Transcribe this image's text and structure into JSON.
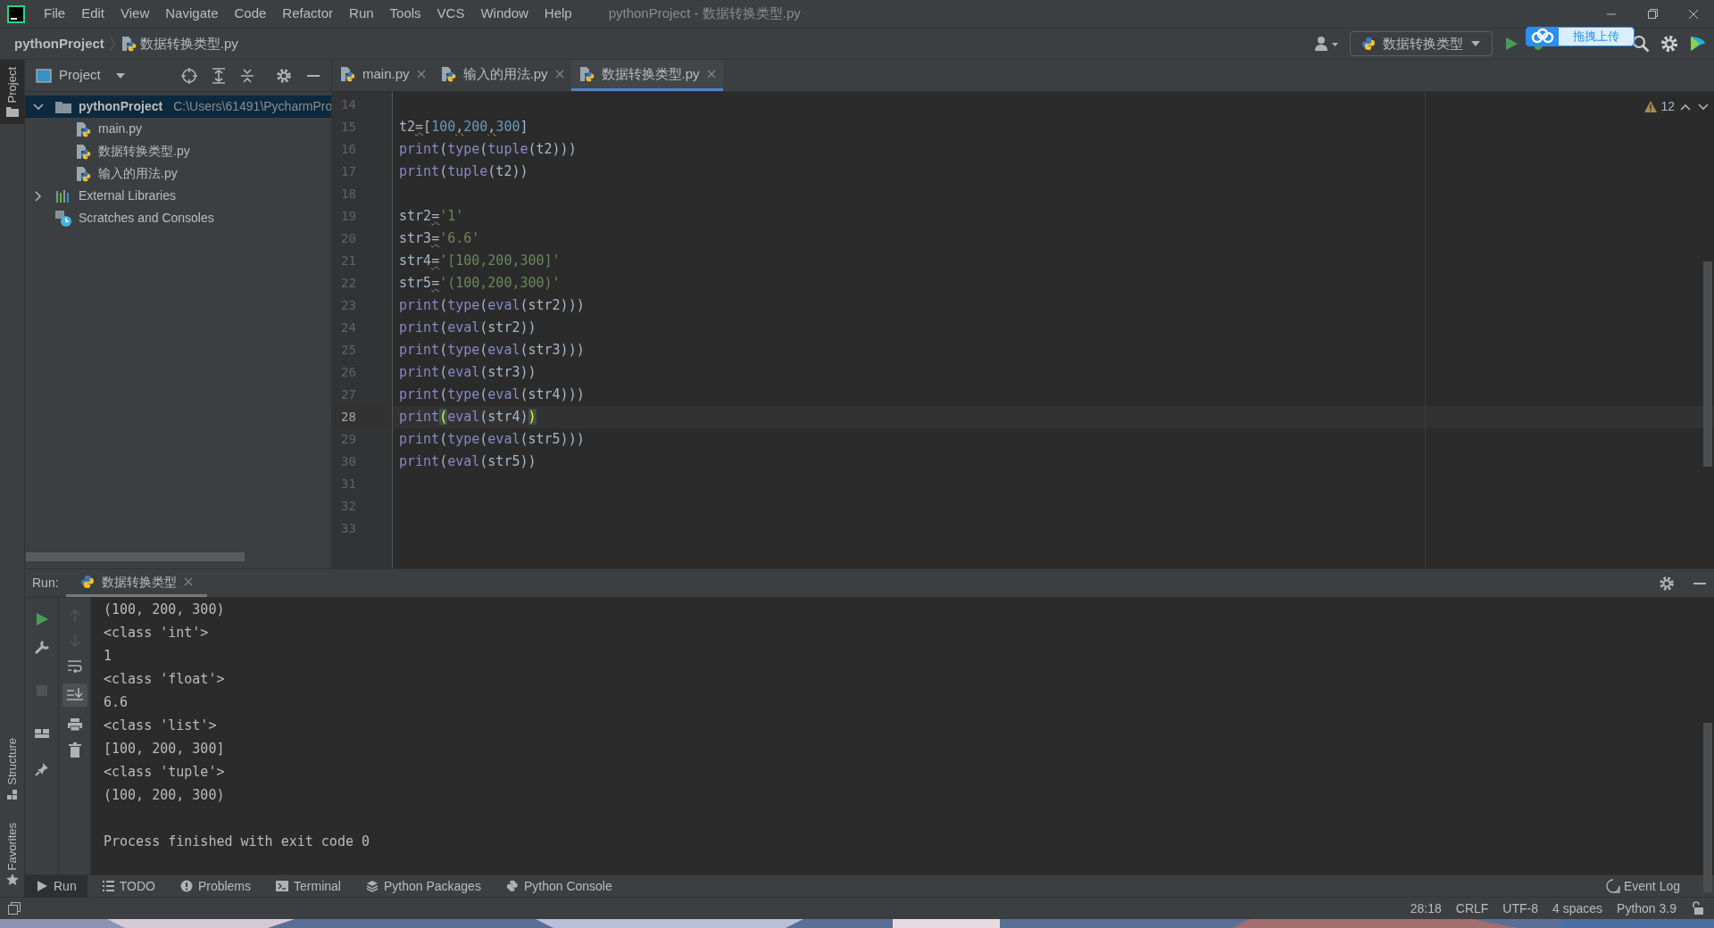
{
  "window": {
    "title": "pythonProject - 数据转换类型.py"
  },
  "menu": [
    "File",
    "Edit",
    "View",
    "Navigate",
    "Code",
    "Refactor",
    "Run",
    "Tools",
    "VCS",
    "Window",
    "Help"
  ],
  "breadcrumb": [
    "pythonProject",
    "数据转换类型.py"
  ],
  "toolbar": {
    "run_configuration": "数据转换类型"
  },
  "upload_popup": {
    "label": "拖拽上传"
  },
  "side_stripe": {
    "top": [
      {
        "label": "Project",
        "selected": true
      }
    ],
    "bottom": [
      {
        "label": "Structure",
        "selected": false
      },
      {
        "label": "Favorites",
        "selected": false
      }
    ]
  },
  "project_panel": {
    "title": "Project",
    "tree": [
      {
        "label": "pythonProject",
        "path": "C:\\Users\\61491\\PycharmPro",
        "kind": "folder",
        "expanded": true,
        "selected": true,
        "children": [
          {
            "label": "main.py",
            "kind": "python_file",
            "selected": false
          },
          {
            "label": "数据转换类型.py",
            "kind": "python_file",
            "selected": false
          },
          {
            "label": "输入的用法.py",
            "kind": "python_file",
            "selected": false
          }
        ]
      },
      {
        "label": "External Libraries",
        "kind": "libraries",
        "expanded": false,
        "selected": false
      },
      {
        "label": "Scratches and Consoles",
        "kind": "scratches",
        "selected": false
      }
    ]
  },
  "tabs": [
    {
      "label": "main.py",
      "selected": false
    },
    {
      "label": "输入的用法.py",
      "selected": false
    },
    {
      "label": "数据转换类型.py",
      "selected": true
    }
  ],
  "editor": {
    "warning_count": "12",
    "lines": [
      {
        "number": "14",
        "current": false
      },
      {
        "number": "15",
        "current": false,
        "tokens": [
          {
            "text": "t2",
            "kind": "plain"
          },
          {
            "text": "=",
            "kind": "weak_warning"
          },
          {
            "text": "[",
            "kind": "plain"
          },
          {
            "text": "100",
            "kind": "number"
          },
          {
            "text": ",",
            "kind": "warning"
          },
          {
            "text": "200",
            "kind": "number"
          },
          {
            "text": ",",
            "kind": "warning"
          },
          {
            "text": "300",
            "kind": "number"
          },
          {
            "text": "]",
            "kind": "plain"
          }
        ]
      },
      {
        "number": "16",
        "current": false,
        "tokens": [
          {
            "text": "print",
            "kind": "builtin"
          },
          {
            "text": "(",
            "kind": "plain"
          },
          {
            "text": "type",
            "kind": "builtin"
          },
          {
            "text": "(",
            "kind": "plain"
          },
          {
            "text": "tuple",
            "kind": "builtin"
          },
          {
            "text": "(t2)))",
            "kind": "plain"
          }
        ]
      },
      {
        "number": "17",
        "current": false,
        "tokens": [
          {
            "text": "print",
            "kind": "builtin"
          },
          {
            "text": "(",
            "kind": "plain"
          },
          {
            "text": "tuple",
            "kind": "builtin"
          },
          {
            "text": "(t2))",
            "kind": "plain"
          }
        ]
      },
      {
        "number": "18",
        "current": false
      },
      {
        "number": "19",
        "current": false,
        "tokens": [
          {
            "text": "str2",
            "kind": "plain"
          },
          {
            "text": "=",
            "kind": "weak_warning"
          },
          {
            "text": "'1'",
            "kind": "string"
          }
        ]
      },
      {
        "number": "20",
        "current": false,
        "tokens": [
          {
            "text": "str3",
            "kind": "plain"
          },
          {
            "text": "=",
            "kind": "weak_warning"
          },
          {
            "text": "'6.6'",
            "kind": "string"
          }
        ]
      },
      {
        "number": "21",
        "current": false,
        "tokens": [
          {
            "text": "str4",
            "kind": "plain"
          },
          {
            "text": "=",
            "kind": "weak_warning"
          },
          {
            "text": "'[100,200,300]'",
            "kind": "string"
          }
        ]
      },
      {
        "number": "22",
        "current": false,
        "tokens": [
          {
            "text": "str5",
            "kind": "plain"
          },
          {
            "text": "=",
            "kind": "weak_warning"
          },
          {
            "text": "'(100,200,300)'",
            "kind": "string"
          }
        ]
      },
      {
        "number": "23",
        "current": false,
        "tokens": [
          {
            "text": "print",
            "kind": "builtin"
          },
          {
            "text": "(",
            "kind": "plain"
          },
          {
            "text": "type",
            "kind": "builtin"
          },
          {
            "text": "(",
            "kind": "plain"
          },
          {
            "text": "eval",
            "kind": "builtin"
          },
          {
            "text": "(str2)))",
            "kind": "plain"
          }
        ]
      },
      {
        "number": "24",
        "current": false,
        "tokens": [
          {
            "text": "print",
            "kind": "builtin"
          },
          {
            "text": "(",
            "kind": "plain"
          },
          {
            "text": "eval",
            "kind": "builtin"
          },
          {
            "text": "(str2))",
            "kind": "plain"
          }
        ]
      },
      {
        "number": "25",
        "current": false,
        "tokens": [
          {
            "text": "print",
            "kind": "builtin"
          },
          {
            "text": "(",
            "kind": "plain"
          },
          {
            "text": "type",
            "kind": "builtin"
          },
          {
            "text": "(",
            "kind": "plain"
          },
          {
            "text": "eval",
            "kind": "builtin"
          },
          {
            "text": "(str3)))",
            "kind": "plain"
          }
        ]
      },
      {
        "number": "26",
        "current": false,
        "tokens": [
          {
            "text": "print",
            "kind": "builtin"
          },
          {
            "text": "(",
            "kind": "plain"
          },
          {
            "text": "eval",
            "kind": "builtin"
          },
          {
            "text": "(str3))",
            "kind": "plain"
          }
        ]
      },
      {
        "number": "27",
        "current": false,
        "tokens": [
          {
            "text": "print",
            "kind": "builtin"
          },
          {
            "text": "(",
            "kind": "plain"
          },
          {
            "text": "type",
            "kind": "builtin"
          },
          {
            "text": "(",
            "kind": "plain"
          },
          {
            "text": "eval",
            "kind": "builtin"
          },
          {
            "text": "(str4)))",
            "kind": "plain"
          }
        ]
      },
      {
        "number": "28",
        "current": true,
        "tokens": [
          {
            "text": "print",
            "kind": "builtin"
          },
          {
            "text": "(",
            "kind": "brace_match"
          },
          {
            "text": "eval",
            "kind": "builtin"
          },
          {
            "text": "(str4)",
            "kind": "plain"
          },
          {
            "text": ")",
            "kind": "brace_match"
          }
        ]
      },
      {
        "number": "29",
        "current": false,
        "tokens": [
          {
            "text": "print",
            "kind": "builtin"
          },
          {
            "text": "(",
            "kind": "plain"
          },
          {
            "text": "type",
            "kind": "builtin"
          },
          {
            "text": "(",
            "kind": "plain"
          },
          {
            "text": "eval",
            "kind": "builtin"
          },
          {
            "text": "(str5)))",
            "kind": "plain"
          }
        ]
      },
      {
        "number": "30",
        "current": false,
        "tokens": [
          {
            "text": "print",
            "kind": "builtin"
          },
          {
            "text": "(",
            "kind": "plain"
          },
          {
            "text": "eval",
            "kind": "builtin"
          },
          {
            "text": "(str5))",
            "kind": "plain"
          }
        ]
      },
      {
        "number": "31",
        "current": false
      },
      {
        "number": "32",
        "current": false
      },
      {
        "number": "33",
        "current": false
      }
    ]
  },
  "run_panel": {
    "label": "Run:",
    "tab": "数据转换类型",
    "output": [
      "(100, 200, 300)",
      "<class 'int'>",
      "1",
      "<class 'float'>",
      "6.6",
      "<class 'list'>",
      "[100, 200, 300]",
      "<class 'tuple'>",
      "(100, 200, 300)"
    ],
    "exit_message": "Process finished with exit code 0"
  },
  "tool_tabs": [
    {
      "label": "Run",
      "kind": "run",
      "selected": true
    },
    {
      "label": "TODO",
      "kind": "todo",
      "selected": false
    },
    {
      "label": "Problems",
      "kind": "problems",
      "selected": false
    },
    {
      "label": "Terminal",
      "kind": "terminal",
      "selected": false
    },
    {
      "label": "Python Packages",
      "kind": "packages",
      "selected": false
    },
    {
      "label": "Python Console",
      "kind": "console",
      "selected": false
    }
  ],
  "event_log": "Event Log",
  "status_bar": [
    "28:18",
    "CRLF",
    "UTF-8",
    "4 spaces",
    "Python 3.9"
  ]
}
